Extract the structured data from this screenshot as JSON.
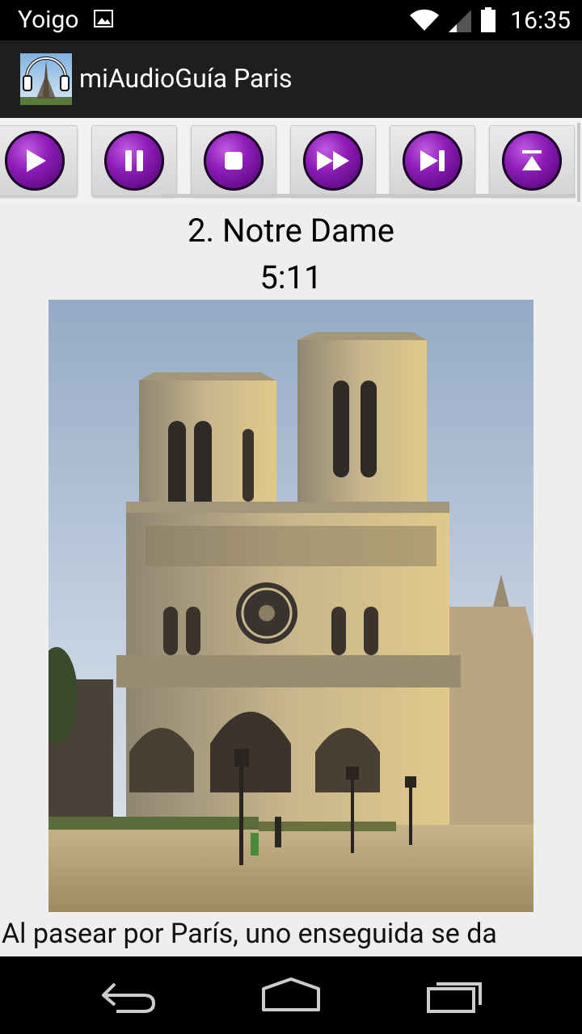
{
  "status_bar": {
    "carrier": "Yoigo",
    "time": "16:35",
    "icons": [
      "image-notification-icon",
      "wifi-icon",
      "signal-icon",
      "battery-icon"
    ]
  },
  "action_bar": {
    "title": "miAudioGuía Paris",
    "icon": "app-headphones-eiffel-icon"
  },
  "toolbar": {
    "buttons": [
      {
        "name": "play",
        "icon": "play-icon"
      },
      {
        "name": "pause",
        "icon": "pause-icon"
      },
      {
        "name": "stop",
        "icon": "stop-icon"
      },
      {
        "name": "fast-forward",
        "icon": "fast-forward-icon"
      },
      {
        "name": "next",
        "icon": "skip-next-icon"
      },
      {
        "name": "eject",
        "icon": "eject-icon"
      }
    ],
    "accent_color": "#7a1aa6"
  },
  "track": {
    "title": "2. Notre Dame",
    "duration": "5:11"
  },
  "description": "Al pasear por París, uno enseguida se da",
  "navigation": {
    "icons": [
      "back-icon",
      "home-icon",
      "recents-icon"
    ]
  }
}
